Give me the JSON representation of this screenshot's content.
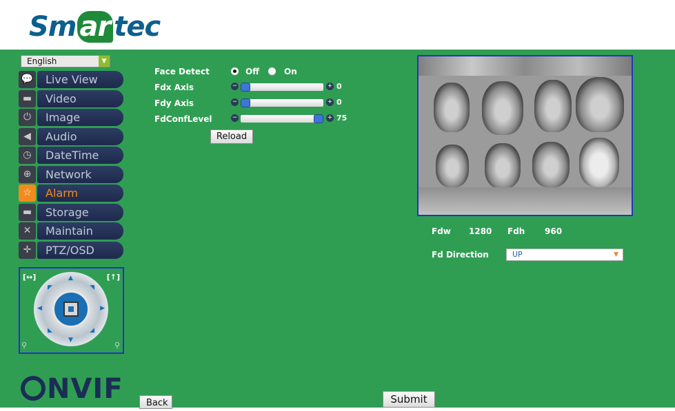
{
  "header": {
    "logo_text": "Smartec"
  },
  "language": {
    "selected": "English"
  },
  "menu": {
    "items": [
      {
        "label": "Live View",
        "icon": "chat-icon"
      },
      {
        "label": "Video",
        "icon": "camera-icon"
      },
      {
        "label": "Image",
        "icon": "power-icon"
      },
      {
        "label": "Audio",
        "icon": "speaker-icon"
      },
      {
        "label": "DateTime",
        "icon": "clock-icon"
      },
      {
        "label": "Network",
        "icon": "globe-icon"
      },
      {
        "label": "Alarm",
        "icon": "star-icon",
        "active": true
      },
      {
        "label": "Storage",
        "icon": "drive-icon"
      },
      {
        "label": "Maintain",
        "icon": "tools-icon"
      },
      {
        "label": "PTZ/OSD",
        "icon": "crosshair-icon"
      }
    ]
  },
  "settings": {
    "face_detect": {
      "label": "Face Detect",
      "off_label": "Off",
      "on_label": "On",
      "value": "Off"
    },
    "fdx_axis": {
      "label": "Fdx Axis",
      "value": "0",
      "fraction": 0.0
    },
    "fdy_axis": {
      "label": "Fdy Axis",
      "value": "0",
      "fraction": 0.0
    },
    "fd_conf_level": {
      "label": "FdConfLevel",
      "value": "75",
      "fraction": 1.0
    },
    "reload_label": "Reload"
  },
  "preview": {
    "fdw_label": "Fdw",
    "fdw_value": "1280",
    "fdh_label": "Fdh",
    "fdh_value": "960"
  },
  "direction": {
    "label": "Fd Direction",
    "selected": "UP"
  },
  "footer": {
    "back_label": "Back",
    "submit_label": "Submit",
    "onvif_text": "NVIF"
  },
  "colors": {
    "background": "#2f9e53",
    "menu_active": "#f28b1e",
    "border_blue": "#2433c4"
  }
}
